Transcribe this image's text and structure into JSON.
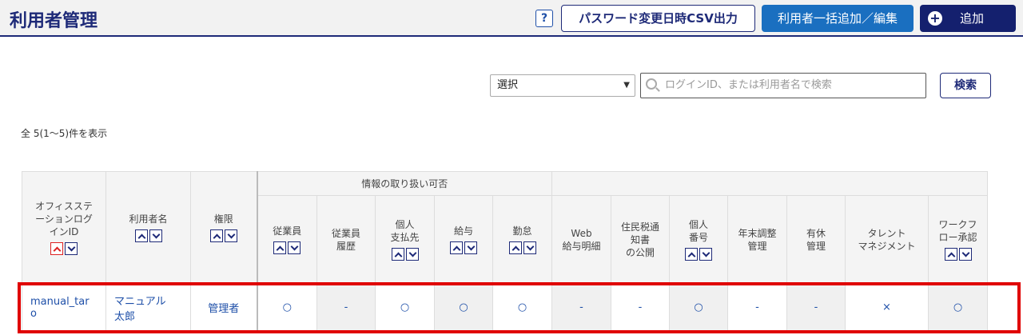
{
  "header": {
    "title": "利用者管理",
    "help": "?",
    "csv_button": "パスワード変更日時CSV出力",
    "bulk_button": "利用者一括追加／編集",
    "add_button": "追加",
    "add_icon": "plus-circle-icon"
  },
  "filter": {
    "select_value": "選択",
    "search_placeholder": "ログインID、または利用者名で検索",
    "search_button": "検索"
  },
  "count_text": "全 5(1～5)件を表示",
  "table": {
    "col_login": [
      "オフィスステ",
      "ーションログ",
      "インID"
    ],
    "col_name": "利用者名",
    "col_role": "権限",
    "group_header": "情報の取り扱い可否",
    "permissions": [
      {
        "label": [
          "従業員"
        ],
        "sortable": true
      },
      {
        "label": [
          "従業員",
          "履歴"
        ],
        "sortable": false
      },
      {
        "label": [
          "個人",
          "支払先"
        ],
        "sortable": true
      },
      {
        "label": [
          "給与"
        ],
        "sortable": true
      },
      {
        "label": [
          "勤怠"
        ],
        "sortable": true
      },
      {
        "label": [
          "Web",
          "給与明細"
        ],
        "sortable": false
      },
      {
        "label": [
          "住民税通",
          "知書",
          "の公開"
        ],
        "sortable": false
      },
      {
        "label": [
          "個人",
          "番号"
        ],
        "sortable": true
      },
      {
        "label": [
          "年末調整",
          "管理"
        ],
        "sortable": false
      },
      {
        "label": [
          "有休",
          "管理"
        ],
        "sortable": false
      },
      {
        "label": [
          "タレント",
          "マネジメント"
        ],
        "sortable": false
      },
      {
        "label": [
          "ワークフ",
          "ロー承認"
        ],
        "sortable": true
      }
    ],
    "row": {
      "login_id": [
        "manual_tar",
        "o"
      ],
      "name": [
        "マニュアル",
        "太郎"
      ],
      "role": "管理者",
      "values": [
        "○",
        "-",
        "○",
        "○",
        "○",
        "-",
        "-",
        "○",
        "-",
        "-",
        "×",
        "○"
      ]
    }
  },
  "colors": {
    "accent": "#1e2a78",
    "blue_button": "#1a6fc0",
    "highlight": "#e00000"
  }
}
